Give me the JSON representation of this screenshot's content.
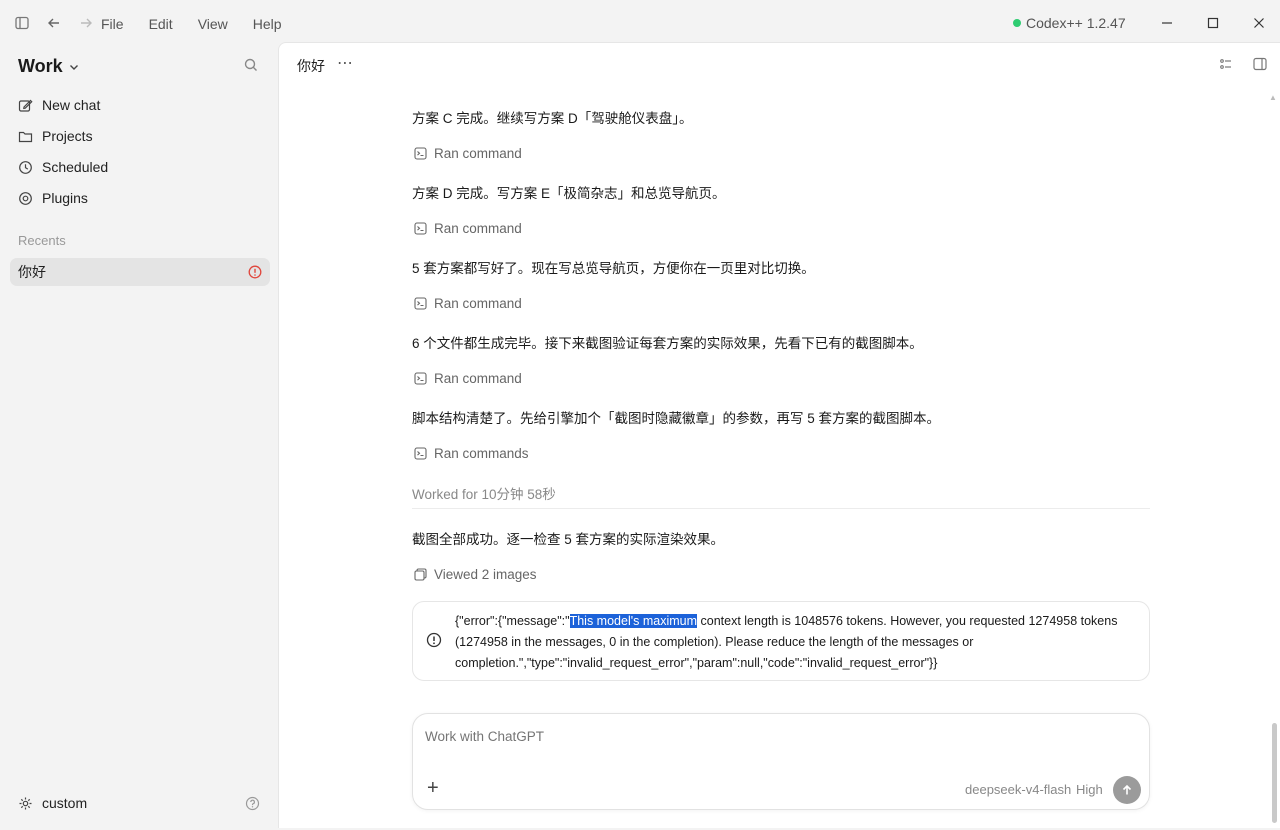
{
  "titlebar": {
    "menu": [
      "File",
      "Edit",
      "View",
      "Help"
    ],
    "app_title": "Codex++ 1.2.47"
  },
  "sidebar": {
    "workspace": "Work",
    "nav": [
      {
        "label": "New chat",
        "icon": "edit-icon"
      },
      {
        "label": "Projects",
        "icon": "folder-icon"
      },
      {
        "label": "Scheduled",
        "icon": "clock-icon"
      },
      {
        "label": "Plugins",
        "icon": "plugin-icon"
      }
    ],
    "recents_label": "Recents",
    "recents": [
      {
        "label": "你好",
        "status": "error"
      }
    ],
    "footer": {
      "label": "custom"
    }
  },
  "main": {
    "chat_title": "你好",
    "messages": [
      {
        "type": "text",
        "text": "方案 C 完成。继续写方案 D「驾驶舱仪表盘」。"
      },
      {
        "type": "command",
        "text": "Ran command"
      },
      {
        "type": "text",
        "text": "方案 D 完成。写方案 E「极简杂志」和总览导航页。"
      },
      {
        "type": "command",
        "text": "Ran command"
      },
      {
        "type": "text",
        "text": "5 套方案都写好了。现在写总览导航页，方便你在一页里对比切换。"
      },
      {
        "type": "command",
        "text": "Ran command"
      },
      {
        "type": "text",
        "text": "6 个文件都生成完毕。接下来截图验证每套方案的实际效果，先看下已有的截图脚本。"
      },
      {
        "type": "command",
        "text": "Ran command"
      },
      {
        "type": "text",
        "text": "脚本结构清楚了。先给引擎加个「截图时隐藏徽章」的参数，再写 5 套方案的截图脚本。"
      },
      {
        "type": "command",
        "text": "Ran commands"
      }
    ],
    "worked_for": "Worked for 10分钟 58秒",
    "final_text": "截图全部成功。逐一检查 5 套方案的实际渲染效果。",
    "viewed": "Viewed 2 images",
    "error": {
      "prefix": "{\"error\":{\"message\":\"",
      "highlight": "This model's maximum",
      "rest": " context length is 1048576 tokens. However, you requested 1274958 tokens (1274958 in the messages, 0 in the completion). Please reduce the length of the messages or completion.\",\"type\":\"invalid_request_error\",\"param\":null,\"code\":\"invalid_request_error\"}}"
    },
    "composer": {
      "placeholder": "Work with ChatGPT",
      "model": "deepseek-v4-flash",
      "effort": "High"
    }
  }
}
